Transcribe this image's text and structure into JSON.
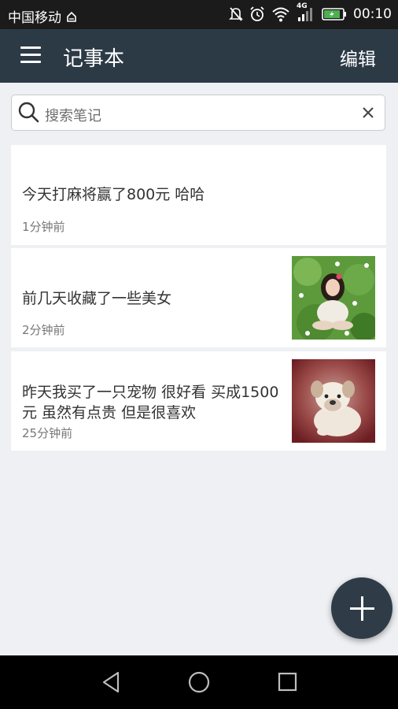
{
  "status_bar": {
    "carrier": "中国移动",
    "network": "4G",
    "time": "00:10"
  },
  "app_bar": {
    "title": "记事本",
    "edit_label": "编辑"
  },
  "search": {
    "placeholder": "搜索笔记"
  },
  "notes": [
    {
      "text": "今天打麻将赢了800元  哈哈",
      "time": "1分钟前"
    },
    {
      "text": "前几天收藏了一些美女",
      "time": "2分钟前",
      "thumbnail": "photo-woman-on-grass"
    },
    {
      "text": "昨天我买了一只宠物 很好看 买成1500元  虽然有点贵 但是很喜欢",
      "time": "25分钟前",
      "thumbnail": "photo-bulldog-puppy"
    }
  ],
  "icons": {
    "menu": "menu-icon",
    "search": "search-icon",
    "clear": "close-icon",
    "fab": "plus-icon",
    "nav_back": "back-icon",
    "nav_home": "home-icon",
    "nav_recent": "recent-apps-icon"
  },
  "colors": {
    "app_bar": "#2c3a46",
    "fab": "#2f3c48",
    "background": "#eef0f3",
    "status_bar": "#1b1b1b"
  }
}
